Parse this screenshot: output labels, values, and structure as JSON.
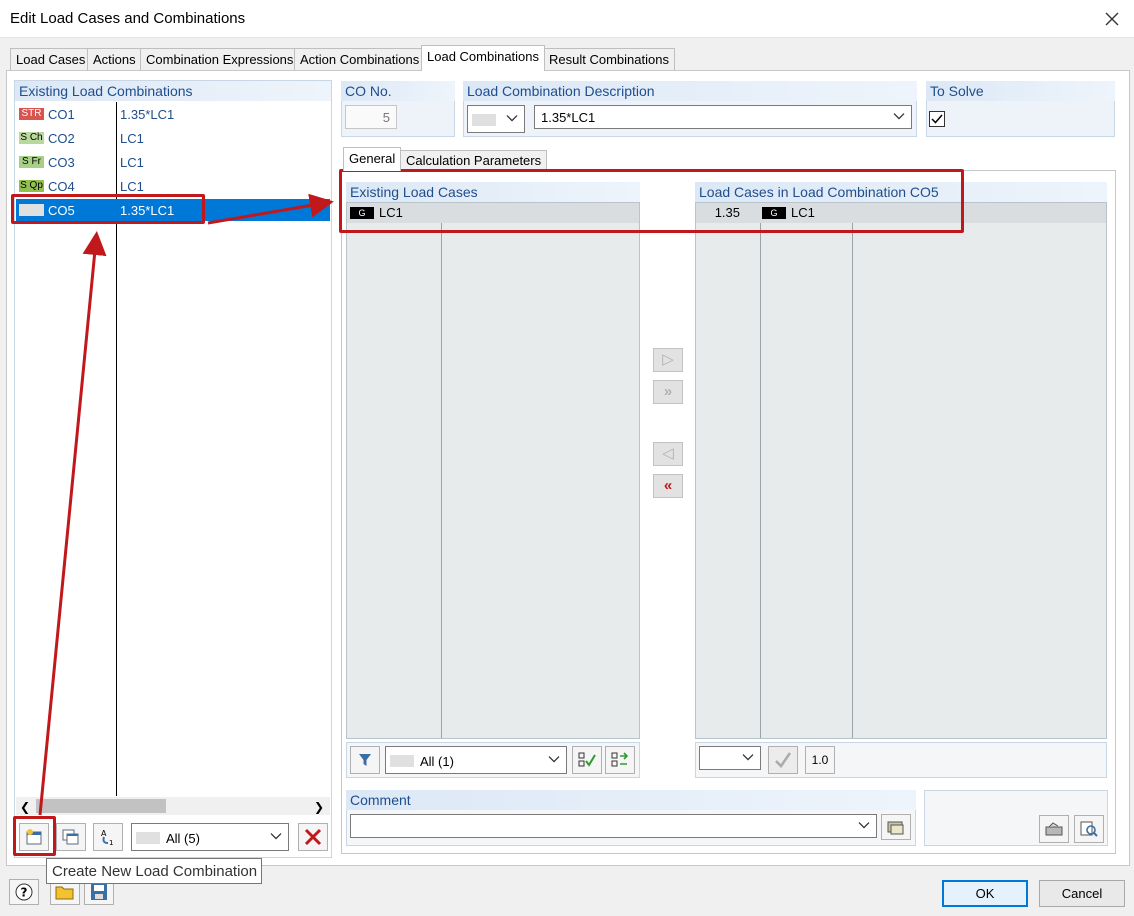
{
  "window": {
    "title": "Edit Load Cases and Combinations"
  },
  "tabs": [
    "Load Cases",
    "Actions",
    "Combination Expressions",
    "Action Combinations",
    "Load Combinations",
    "Result Combinations"
  ],
  "left": {
    "header": "Existing Load Combinations",
    "rows": [
      {
        "badge": "STR",
        "name": "CO1",
        "expr": "1.35*LC1"
      },
      {
        "badge": "S Ch",
        "name": "CO2",
        "expr": "LC1"
      },
      {
        "badge": "S Fr",
        "name": "CO3",
        "expr": "LC1"
      },
      {
        "badge": "S Qp",
        "name": "CO4",
        "expr": "LC1"
      },
      {
        "badge": "",
        "name": "CO5",
        "expr": "1.35*LC1"
      }
    ],
    "filter_value": "All (5)"
  },
  "co_no": {
    "label": "CO No.",
    "value": "5"
  },
  "description": {
    "label": "Load Combination Description",
    "value": "1.35*LC1"
  },
  "to_solve": {
    "label": "To Solve",
    "checked": true
  },
  "subtabs": [
    "General",
    "Calculation Parameters"
  ],
  "existing_cases": {
    "header": "Existing Load Cases",
    "rows": [
      {
        "badge": "G",
        "name": "LC1"
      }
    ],
    "filter_value": "All (1)"
  },
  "combo_cases": {
    "header": "Load Cases in Load Combination CO5",
    "rows": [
      {
        "factor": "1.35",
        "badge": "G",
        "name": "LC1"
      }
    ],
    "factor_button": "1.0"
  },
  "comment": {
    "label": "Comment",
    "value": ""
  },
  "tooltip": "Create New Load Combination",
  "buttons": {
    "ok": "OK",
    "cancel": "Cancel"
  },
  "colors": {
    "accent": "#0078d7",
    "highlight_red": "#c0181b",
    "header_text": "#1f4e8c",
    "str_badge": "#d9534f",
    "sls_badge": "#92c050"
  }
}
